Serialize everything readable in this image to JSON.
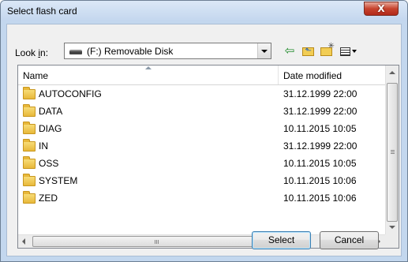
{
  "window": {
    "title": "Select flash card",
    "close_glyph": "X"
  },
  "toolbar": {
    "look_in_label_prefix": "Look ",
    "look_in_label_hotkey": "i",
    "look_in_label_suffix": "n:",
    "location": "(F:) Removable Disk",
    "icons": [
      "drive-icon",
      "back-icon",
      "up-folder-icon",
      "new-folder-icon",
      "view-menu-icon"
    ]
  },
  "file_list": {
    "columns": [
      "Name",
      "Date modified"
    ],
    "sorted_by": "Name",
    "rows": [
      {
        "name": "AUTOCONFIG",
        "date": "31.12.1999 22:00"
      },
      {
        "name": "DATA",
        "date": "31.12.1999 22:00"
      },
      {
        "name": "DIAG",
        "date": "10.11.2015 10:05"
      },
      {
        "name": "IN",
        "date": "31.12.1999 22:00"
      },
      {
        "name": "OSS",
        "date": "10.11.2015 10:05"
      },
      {
        "name": "SYSTEM",
        "date": "10.11.2015 10:06"
      },
      {
        "name": "ZED",
        "date": "10.11.2015 10:06"
      }
    ]
  },
  "buttons": {
    "select": "Select",
    "cancel": "Cancel"
  }
}
